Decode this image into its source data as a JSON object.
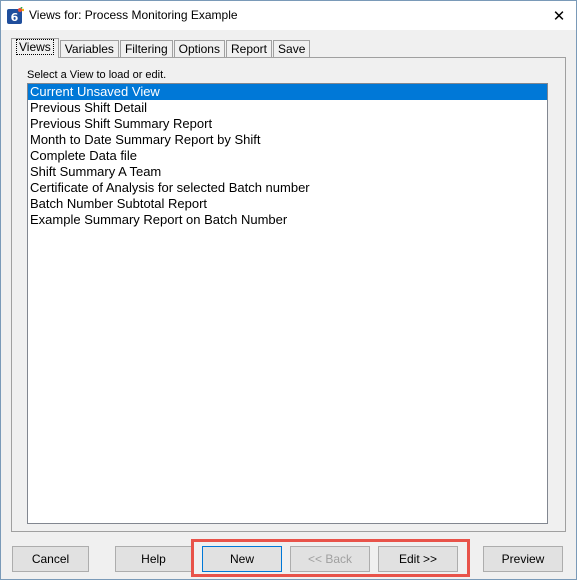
{
  "window": {
    "title": "Views for: Process Monitoring Example",
    "app_icon": "spc-app-icon",
    "close_glyph": "✕"
  },
  "tabs": [
    {
      "label": "Views",
      "active": true
    },
    {
      "label": "Variables",
      "active": false
    },
    {
      "label": "Filtering",
      "active": false
    },
    {
      "label": "Options",
      "active": false
    },
    {
      "label": "Report",
      "active": false
    },
    {
      "label": "Save",
      "active": false
    }
  ],
  "views_panel": {
    "prompt": "Select a View to load or edit.",
    "items": [
      "Current Unsaved View",
      "Previous Shift Detail",
      "Previous Shift Summary Report",
      "Month to Date Summary Report by Shift",
      "Complete Data file",
      "Shift Summary A Team",
      "Certificate of Analysis for selected Batch number",
      "Batch Number Subtotal Report",
      "Example Summary Report on Batch Number"
    ],
    "selected_index": 0
  },
  "buttons": {
    "cancel": "Cancel",
    "help": "Help",
    "new": "New",
    "back": "<< Back",
    "edit": "Edit >>",
    "preview": "Preview"
  },
  "colors": {
    "selection": "#0078d7",
    "highlight_box": "#e8534a"
  }
}
